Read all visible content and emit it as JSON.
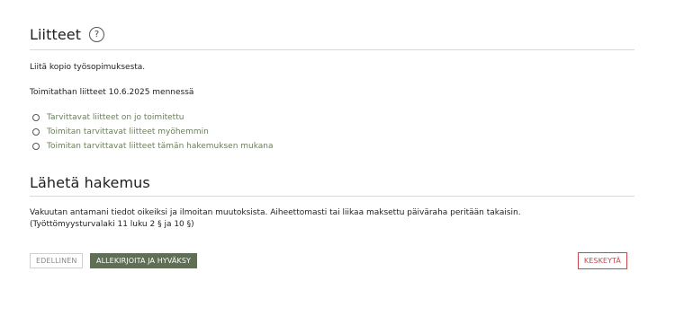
{
  "attachments": {
    "title": "Liitteet",
    "help_icon": "?",
    "intro": "Liitä kopio työsopimuksesta.",
    "deadline": "Toimitathan liitteet 10.6.2025 mennessä",
    "options": [
      "Tarvittavat liitteet on jo toimitettu",
      "Toimitan tarvittavat liitteet myöhemmin",
      "Toimitan tarvittavat liitteet tämän hakemuksen mukana"
    ]
  },
  "submit": {
    "title": "Lähetä hakemus",
    "consent_line1": "Vakuutan antamani tiedot oikeiksi ja ilmoitan muutoksista. Aiheettomasti tai liikaa maksettu päiväraha peritään takaisin.",
    "consent_line2": "(Työttömyysturvalaki 11 luku 2 § ja 10 §)"
  },
  "buttons": {
    "previous": "EDELLINEN",
    "sign": "ALLEKIRJOITA JA HYVÄKSY",
    "cancel": "KESKEYTÄ"
  },
  "colors": {
    "accent_green": "#5f6e55",
    "option_text": "#6b7d5e",
    "cancel_red": "#c9474b"
  }
}
